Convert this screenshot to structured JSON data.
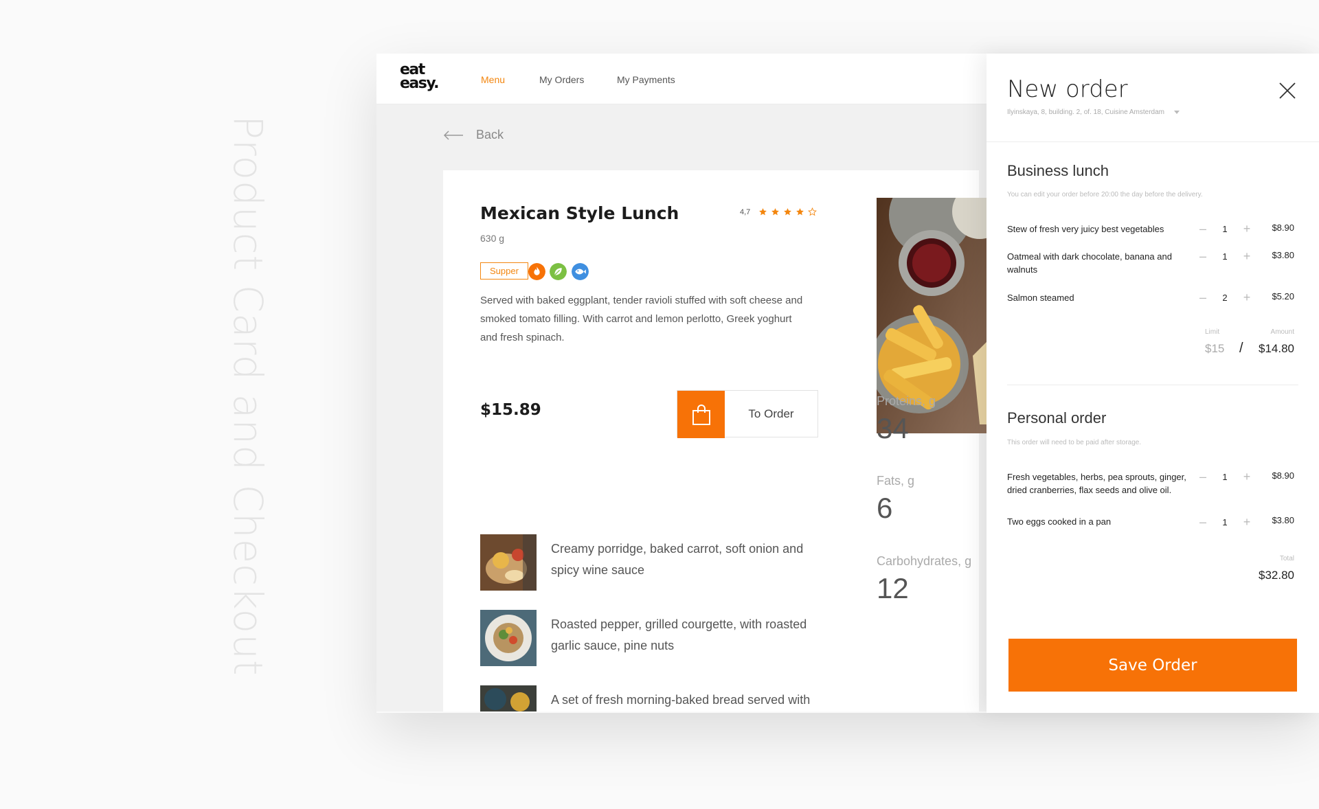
{
  "page_caption": "Product Card and Checkout",
  "brand": {
    "line1": "eat",
    "line2": "easy."
  },
  "nav": {
    "items": [
      "Menu",
      "My Orders",
      "My Payments"
    ]
  },
  "back_label": "Back",
  "product": {
    "title": "Mexican Style Lunch",
    "weight": "630 g",
    "rating_value": "4,7",
    "rating_stars": 4,
    "tag": "Supper",
    "diet_icons": [
      "flame-icon",
      "leaf-icon",
      "fish-icon"
    ],
    "description": "Served with baked eggplant, tender ravioli stuffed with soft cheese and smoked tomato filling. With carrot and lemon perlotto, Greek yoghurt and fresh spinach.",
    "price": "$15.89",
    "order_label": "To Order"
  },
  "dishes": [
    {
      "text": "Creamy porridge, baked carrot, soft onion and spicy wine sauce"
    },
    {
      "text": "Roasted pepper, grilled courgette, with roasted garlic sauce, pine nuts"
    },
    {
      "text": "A set of fresh morning-baked bread served with yemeni skhug, carrot tirshi, sour cream"
    }
  ],
  "nutrition": [
    {
      "label": "Proteins, g",
      "value": "34"
    },
    {
      "label": "Fats, g",
      "value": "6"
    },
    {
      "label": "Carbohydrates, g",
      "value": "12"
    }
  ],
  "order_panel": {
    "title": "New order",
    "address": "Ilyinskaya, 8, building. 2, of. 18, Cuisine Amsterdam",
    "business": {
      "title": "Business lunch",
      "note": "You can edit your order before 20:00 the day before the delivery.",
      "items": [
        {
          "name": "Stew of fresh very juicy best vegetables",
          "qty": "1",
          "price": "$8.90"
        },
        {
          "name": "Oatmeal with dark chocolate, banana and walnuts",
          "qty": "1",
          "price": "$3.80"
        },
        {
          "name": "Salmon steamed",
          "qty": "2",
          "price": "$5.20"
        }
      ],
      "limit_label": "Limit",
      "amount_label": "Amount",
      "limit": "$15",
      "separator": "/",
      "amount": "$14.80"
    },
    "personal": {
      "title": "Personal order",
      "note": "This order will need to be paid after storage.",
      "items": [
        {
          "name": "Fresh vegetables, herbs, pea sprouts, ginger, dried cranberries, flax seeds and olive oil.",
          "qty": "1",
          "price": "$8.90"
        },
        {
          "name": "Two eggs cooked in a pan",
          "qty": "1",
          "price": "$3.80"
        }
      ],
      "total_label": "Total",
      "total": "$32.80"
    },
    "save_label": "Save Order"
  },
  "colors": {
    "accent": "#f77207",
    "accent_text": "#f3860f",
    "flame": "#f77207",
    "leaf": "#7cc043",
    "fish": "#3f8fe0"
  }
}
